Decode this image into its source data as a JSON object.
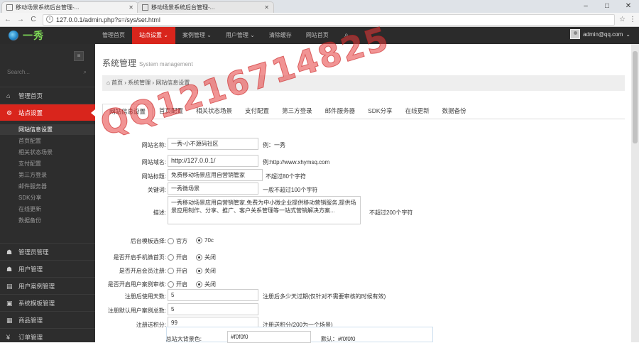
{
  "browser": {
    "tabs": [
      {
        "title": "移动场景系统后台管理-..."
      },
      {
        "title": "移动场景系统后台管理-..."
      }
    ],
    "url": "127.0.0.1/admin.php?s=/sys/set.html",
    "nav_back": "←",
    "nav_forward": "→",
    "nav_reload": "C",
    "star": "☆",
    "menu": "⋮",
    "win_min": "–",
    "win_max": "□",
    "win_close": "✕"
  },
  "topbar": {
    "logo_text": "一秀",
    "nav": [
      {
        "label": "管理首页",
        "active": false
      },
      {
        "label": "站点设置 ⌄",
        "active": true
      },
      {
        "label": "案例管理 ⌄",
        "active": false
      },
      {
        "label": "用户管理 ⌄",
        "active": false
      },
      {
        "label": "清除缓存",
        "active": false
      },
      {
        "label": "网站首页",
        "active": false
      }
    ],
    "user_email": "admin@qq.com",
    "user_caret": "⌄"
  },
  "sidebar": {
    "toggle": "≡",
    "search_placeholder": "Search...",
    "items": [
      {
        "label": "管理首页",
        "icon": "home-icon",
        "glyph": "⌂"
      },
      {
        "label": "站点设置",
        "icon": "gears-icon",
        "glyph": "⚙"
      },
      {
        "label": "管理员管理",
        "icon": "user-icon",
        "glyph": "☗"
      },
      {
        "label": "用户管理",
        "icon": "user-icon",
        "glyph": "☗"
      },
      {
        "label": "用户案例管理",
        "icon": "doc-icon",
        "glyph": "▤"
      },
      {
        "label": "系统模板管理",
        "icon": "template-icon",
        "glyph": "▣"
      },
      {
        "label": "商品管理",
        "icon": "goods-icon",
        "glyph": "▦"
      },
      {
        "label": "订单管理",
        "icon": "yen-icon",
        "glyph": "¥"
      }
    ],
    "sub_items": [
      {
        "label": "网站信息设置",
        "active": true
      },
      {
        "label": "首页配置",
        "active": false
      },
      {
        "label": "相关状态场景",
        "active": false
      },
      {
        "label": "支付配置",
        "active": false
      },
      {
        "label": "第三方登录",
        "active": false
      },
      {
        "label": "邮件服务器",
        "active": false
      },
      {
        "label": "SDK分享",
        "active": false
      },
      {
        "label": "在线更新",
        "active": false
      },
      {
        "label": "数据备份",
        "active": false
      }
    ]
  },
  "main": {
    "title": "系统管理",
    "title_en": "System management",
    "breadcrumb": "⌂ 首页 › 系统管理 › 网站信息设置",
    "tabs": [
      {
        "label": "网站信息设置",
        "active": true
      },
      {
        "label": "首页配置",
        "active": false
      },
      {
        "label": "相关状态场景",
        "active": false
      },
      {
        "label": "支付配置",
        "active": false
      },
      {
        "label": "第三方登录",
        "active": false
      },
      {
        "label": "邮件服务器",
        "active": false
      },
      {
        "label": "SDK分享",
        "active": false
      },
      {
        "label": "在线更新",
        "active": false
      },
      {
        "label": "数据备份",
        "active": false
      }
    ],
    "form": {
      "site_name_label": "网站名称:",
      "site_name_value": "一秀-小不源码社区",
      "site_name_hint": "例：一秀",
      "site_url_label": "网站域名:",
      "site_url_value": "http://127.0.0.1/",
      "site_url_hint": "例:http://www.xhymsq.com",
      "site_title_label": "网站标题:",
      "site_title_value": "免费移动场景应用自营销管家",
      "site_title_hint": "不超过80个字符",
      "keywords_label": "关键词:",
      "keywords_value": "一秀微场景",
      "keywords_hint": "一般不超过100个字符",
      "desc_label": "描述:",
      "desc_value": "一秀移动场景应用自营销管家,免费为中小微企业提供移动营销服务,提供场景应用制作、分享、推广、客户关系管理等一站式营销解决方案...",
      "desc_hint": "不超过200个字符",
      "theme_label": "后台模板选择:",
      "theme_opts": [
        {
          "label": "官方",
          "on": false
        },
        {
          "label": "70c",
          "on": true
        }
      ],
      "mobile_home_label": "是否开启手机微首页:",
      "mobile_home_opts": [
        {
          "label": "开启",
          "on": false
        },
        {
          "label": "关闭",
          "on": true
        }
      ],
      "member_reg_label": "是否开启会员注册:",
      "member_reg_opts": [
        {
          "label": "开启",
          "on": false
        },
        {
          "label": "关闭",
          "on": true
        }
      ],
      "user_case_label": "是否开启用户案例审核:",
      "user_case_opts": [
        {
          "label": "开启",
          "on": false
        },
        {
          "label": "关闭",
          "on": true
        }
      ],
      "reg_days_label": "注册后使用天数:",
      "reg_days_value": "5",
      "reg_days_hint": "注册后多少天过期(仅针对不需要审核的时候有效)",
      "default_count_label": "注册默认用户案例总数:",
      "default_count_value": "5",
      "reg_bonus_label": "注册送积分:",
      "reg_bonus_value": "99",
      "reg_bonus_hint": "注册送积分(200为一个场景)",
      "bg_color_label": "总站大背景色:",
      "bg_color_value": "#f0f0f0",
      "bg_color_hint": "默认：#f0f0f0"
    }
  },
  "watermark": "QQ1216714825"
}
